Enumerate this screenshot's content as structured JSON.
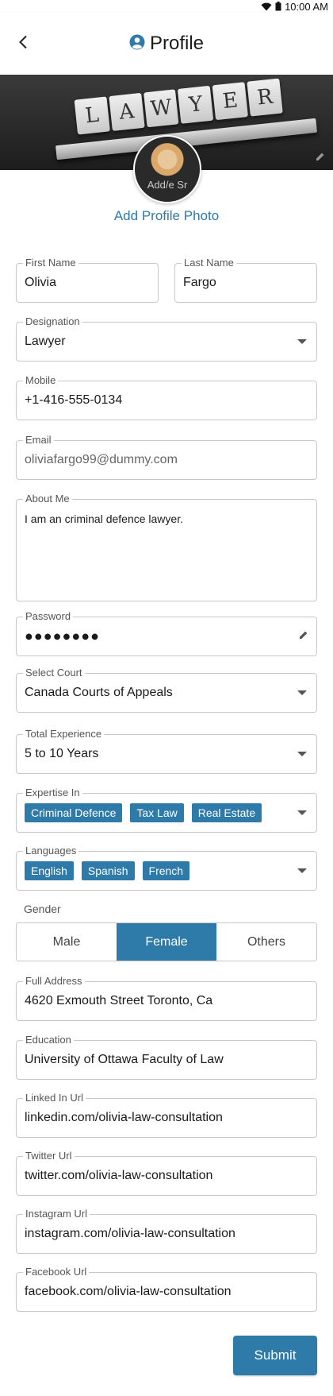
{
  "status": {
    "time": "10:00 AM"
  },
  "header": {
    "title": "Profile"
  },
  "cover": {
    "letters": [
      "L",
      "A",
      "W",
      "Y",
      "E",
      "R"
    ]
  },
  "avatar": {
    "overlay_text": "Add/e Sr"
  },
  "add_photo_label": "Add Profile Photo",
  "form": {
    "first_name": {
      "label": "First Name",
      "value": "Olivia"
    },
    "last_name": {
      "label": "Last Name",
      "value": "Fargo"
    },
    "designation": {
      "label": "Designation",
      "value": "Lawyer"
    },
    "mobile": {
      "label": "Mobile",
      "value": "+1-416-555-0134"
    },
    "email": {
      "label": "Email",
      "value": "oliviafargo99@dummy.com"
    },
    "about": {
      "label": "About Me",
      "value": "I am an criminal defence lawyer."
    },
    "password": {
      "label": "Password",
      "value": "●●●●●●●●"
    },
    "court": {
      "label": "Select Court",
      "value": "Canada Courts of Appeals"
    },
    "experience": {
      "label": "Total Experience",
      "value": "5 to 10 Years"
    },
    "expertise": {
      "label": "Expertise In",
      "chips": [
        "Criminal Defence",
        "Tax Law",
        "Real Estate"
      ]
    },
    "languages": {
      "label": "Languages",
      "chips": [
        "English",
        "Spanish",
        "French"
      ]
    },
    "gender": {
      "label": "Gender",
      "options": [
        "Male",
        "Female",
        "Others"
      ],
      "selected": "Female"
    },
    "address": {
      "label": "Full Address",
      "value": "4620  Exmouth Street Toronto, Ca"
    },
    "education": {
      "label": "Education",
      "value": "University of Ottawa Faculty of Law"
    },
    "linkedin": {
      "label": "Linked In Url",
      "value": "linkedin.com/olivia-law-consultation"
    },
    "twitter": {
      "label": "Twitter Url",
      "value": "twitter.com/olivia-law-consultation"
    },
    "instagram": {
      "label": "Instagram Url",
      "value": "instagram.com/olivia-law-consultation"
    },
    "facebook": {
      "label": "Facebook Url",
      "value": "facebook.com/olivia-law-consultation"
    }
  },
  "submit_label": "Submit",
  "colors": {
    "accent": "#2e7aa8",
    "border": "#c9c9c9"
  }
}
